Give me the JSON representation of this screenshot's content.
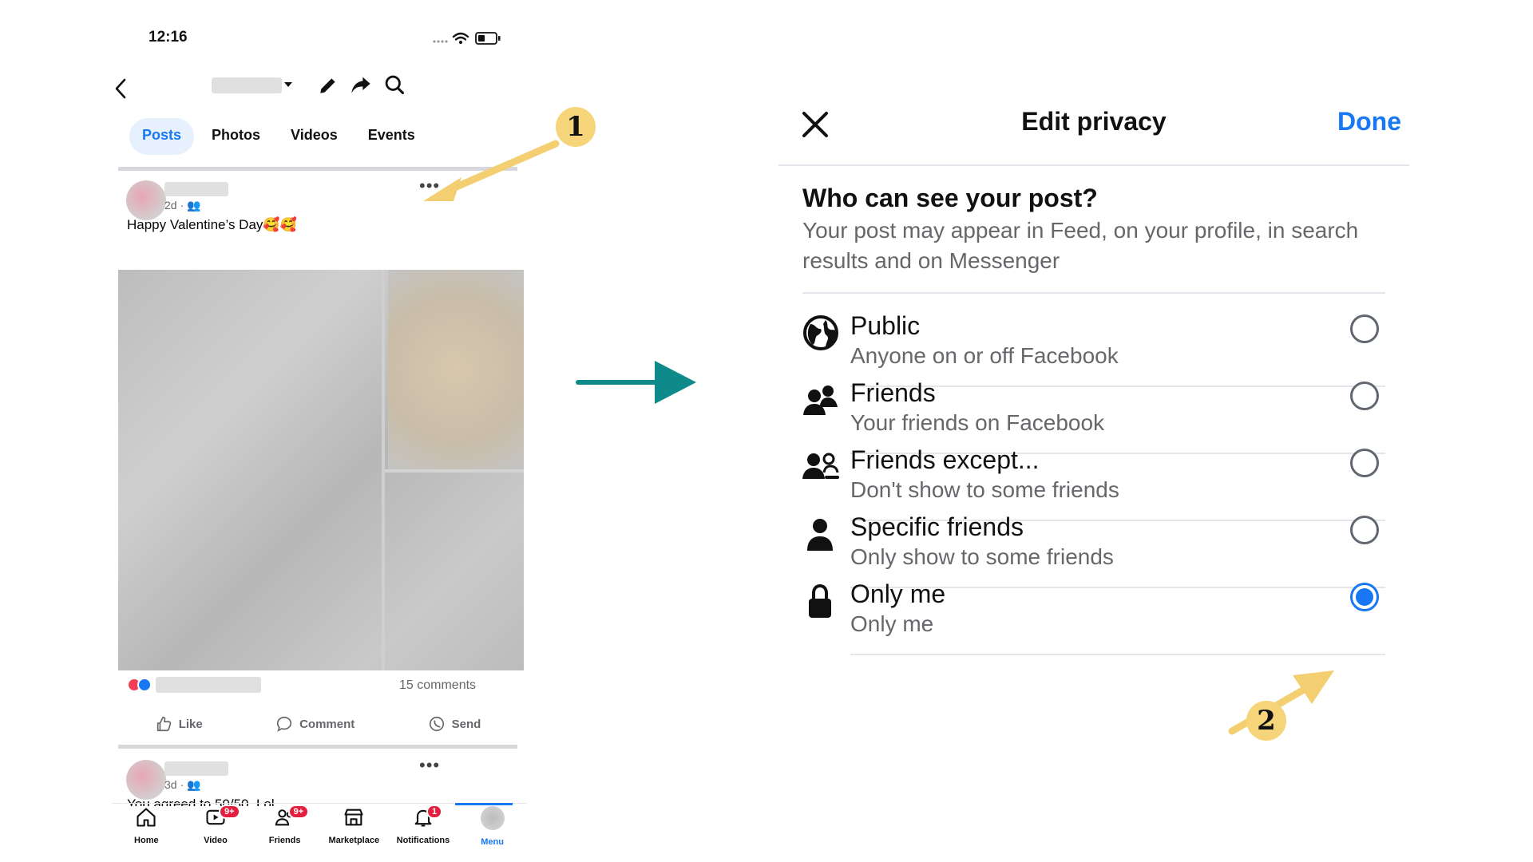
{
  "phone": {
    "status": {
      "time": "12:16"
    },
    "tabs": [
      "Posts",
      "Photos",
      "Videos",
      "Events"
    ],
    "post1": {
      "age": "2d",
      "text": "Happy Valentine’s Day🥰🥰",
      "comments": "15 comments"
    },
    "actions": {
      "like": "Like",
      "comment": "Comment",
      "send": "Send"
    },
    "post2": {
      "age": "3d",
      "text": "You agreed to 50/50. Lol"
    },
    "bottom_nav": [
      {
        "label": "Home",
        "icon": "home-icon",
        "badge": ""
      },
      {
        "label": "Video",
        "icon": "video-icon",
        "badge": "9+"
      },
      {
        "label": "Friends",
        "icon": "friends-icon",
        "badge": "9+"
      },
      {
        "label": "Marketplace",
        "icon": "marketplace-icon",
        "badge": ""
      },
      {
        "label": "Notifications",
        "icon": "bell-icon",
        "badge": "1"
      },
      {
        "label": "Menu",
        "icon": "avatar",
        "badge": ""
      }
    ]
  },
  "privacy": {
    "title": "Edit privacy",
    "done": "Done",
    "question": "Who can see your post?",
    "description": "Your post may appear in Feed, on your profile, in search results and on Messenger",
    "options": [
      {
        "title": "Public",
        "subtitle": "Anyone on or off Facebook",
        "icon": "globe-icon",
        "selected": false
      },
      {
        "title": "Friends",
        "subtitle": "Your friends on Facebook",
        "icon": "friends-icon",
        "selected": false
      },
      {
        "title": "Friends except...",
        "subtitle": "Don't show to some friends",
        "icon": "friends-except-icon",
        "selected": false
      },
      {
        "title": "Specific friends",
        "subtitle": "Only show to some friends",
        "icon": "person-icon",
        "selected": false
      },
      {
        "title": "Only me",
        "subtitle": "Only me",
        "icon": "lock-icon",
        "selected": true
      }
    ]
  },
  "callouts": [
    "1",
    "2"
  ],
  "colors": {
    "accent": "#1877f2",
    "callout": "#f6d47a",
    "arrow": "#0f8a8a"
  }
}
